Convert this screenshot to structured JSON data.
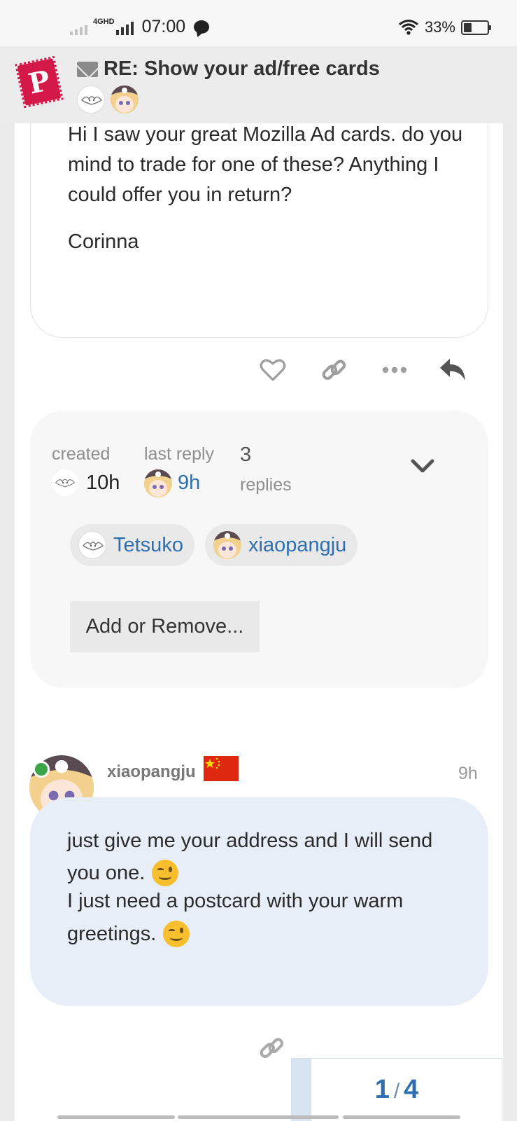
{
  "status_bar": {
    "network_type": "4GHD",
    "time": "07:00",
    "battery_percent": "33%",
    "battery_level": 0.33
  },
  "header": {
    "title": "RE: Show your ad/free cards",
    "logo_letter": "P"
  },
  "first_post": {
    "body": "Hi I saw your great Mozilla Ad cards. do you mind to trade for one of these? Anything I could offer you in return?",
    "signature": "Corinna"
  },
  "post_actions": [
    "heart-icon",
    "link-icon",
    "more-icon",
    "reply-icon"
  ],
  "topic_meta": {
    "created_label": "created",
    "created_value": "10h",
    "last_reply_label": "last reply",
    "last_reply_value": "9h",
    "replies_count": "3",
    "replies_label": "replies",
    "participants": [
      {
        "name": "Tetsuko",
        "avatar": "bat-avatar"
      },
      {
        "name": "xiaopangju",
        "avatar": "girl-avatar"
      }
    ],
    "add_remove_label": "Add or Remove..."
  },
  "reply": {
    "username": "xiaopangju",
    "time": "9h",
    "lines": [
      "just give me your address and I will send",
      "you one.",
      "I just need a postcard with your warm",
      "greetings."
    ]
  },
  "progress": {
    "current": "1",
    "total": "4"
  },
  "colors": {
    "link": "#2f6fb0",
    "logo": "#d41949",
    "reply_bubble": "#e8eef7",
    "online": "#3aa547"
  }
}
